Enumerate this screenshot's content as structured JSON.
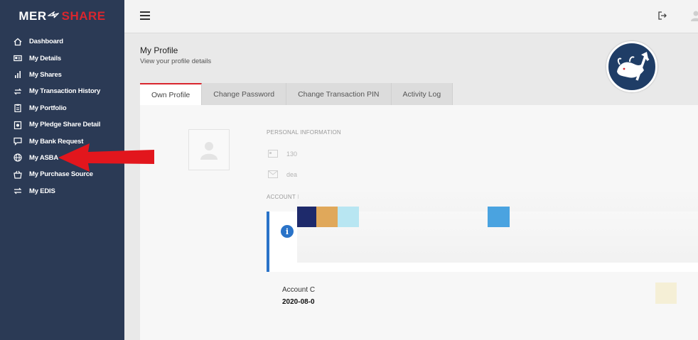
{
  "logo": {
    "part1": "MER",
    "part2": "SHARE"
  },
  "sidebar": {
    "items": [
      {
        "label": "Dashboard",
        "icon": "home-icon"
      },
      {
        "label": "My Details",
        "icon": "id-card-icon"
      },
      {
        "label": "My Shares",
        "icon": "bar-chart-icon"
      },
      {
        "label": "My Transaction History",
        "icon": "transfer-icon"
      },
      {
        "label": "My Portfolio",
        "icon": "clipboard-icon"
      },
      {
        "label": "My Pledge Share Detail",
        "icon": "pledge-icon"
      },
      {
        "label": "My Bank Request",
        "icon": "chat-icon"
      },
      {
        "label": "My ASBA",
        "icon": "globe-icon"
      },
      {
        "label": "My Purchase Source",
        "icon": "basket-icon"
      },
      {
        "label": "My EDIS",
        "icon": "swap-icon"
      }
    ]
  },
  "page": {
    "title": "My Profile",
    "subtitle": "View your profile details"
  },
  "tabs": [
    {
      "label": "Own Profile",
      "active": true
    },
    {
      "label": "Change Password",
      "active": false
    },
    {
      "label": "Change Transaction PIN",
      "active": false
    },
    {
      "label": "Activity Log",
      "active": false
    }
  ],
  "profile": {
    "personal_heading": "PERSONAL INFORMATION",
    "id_value": "130",
    "email_value": "dea",
    "account_heading": "ACCOUNT I",
    "account_label": "Account C",
    "account_value": "2020-08-0"
  },
  "colors": {
    "sidebar": "#2b3a55",
    "accent_red": "#d9262e",
    "info_blue": "#2a73c8",
    "swatches": [
      "#1e2a6b",
      "#e0a85a",
      "#b8e6f2",
      "#4aa3e0"
    ]
  }
}
